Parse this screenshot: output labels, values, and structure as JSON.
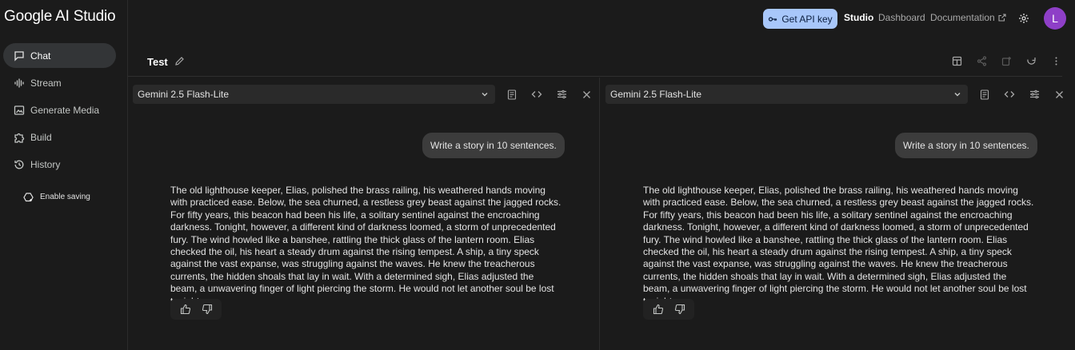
{
  "app": {
    "logo_text": "Google AI Studio"
  },
  "sidebar": {
    "items": [
      {
        "label": "Chat",
        "icon": "chat-icon",
        "active": true
      },
      {
        "label": "Stream",
        "icon": "waveform-icon",
        "active": false
      },
      {
        "label": "Generate Media",
        "icon": "media-icon",
        "active": false
      },
      {
        "label": "Build",
        "icon": "puzzle-icon",
        "active": false
      },
      {
        "label": "History",
        "icon": "history-icon",
        "active": false
      }
    ],
    "enable_saving": "Enable saving"
  },
  "topbar": {
    "api_key_label": "Get API key",
    "links": {
      "studio": "Studio",
      "dashboard": "Dashboard",
      "documentation": "Documentation"
    },
    "avatar_initial": "L",
    "avatar_color": "#8e3fc7",
    "accent_color": "#a8c7fa"
  },
  "page": {
    "title": "Test"
  },
  "panels": [
    {
      "model": "Gemini 2.5 Flash-Lite",
      "user_message": "Write a story in 10 sentences.",
      "response": "The old lighthouse keeper, Elias, polished the brass railing, his weathered hands moving with practiced ease. Below, the sea churned, a restless grey beast against the jagged rocks. For fifty years, this beacon had been his life, a solitary sentinel against the encroaching darkness. Tonight, however, a different kind of darkness loomed, a storm of unprecedented fury. The wind howled like a banshee, rattling the thick glass of the lantern room. Elias checked the oil, his heart a steady drum against the rising tempest. A ship, a tiny speck against the vast expanse, was struggling against the waves. He knew the treacherous currents, the hidden shoals that lay in wait. With a determined sigh, Elias adjusted the beam, a unwavering finger of light piercing the storm. He would not let another soul be lost tonight."
    },
    {
      "model": "Gemini 2.5 Flash-Lite",
      "user_message": "Write a story in 10 sentences.",
      "response": "The old lighthouse keeper, Elias, polished the brass railing, his weathered hands moving with practiced ease. Below, the sea churned, a restless grey beast against the jagged rocks. For fifty years, this beacon had been his life, a solitary sentinel against the encroaching darkness. Tonight, however, a different kind of darkness loomed, a storm of unprecedented fury. The wind howled like a banshee, rattling the thick glass of the lantern room. Elias checked the oil, his heart a steady drum against the rising tempest. A ship, a tiny speck against the vast expanse, was struggling against the waves. He knew the treacherous currents, the hidden shoals that lay in wait. With a determined sigh, Elias adjusted the beam, a unwavering finger of light piercing the storm. He would not let another soul be lost tonight."
    }
  ]
}
